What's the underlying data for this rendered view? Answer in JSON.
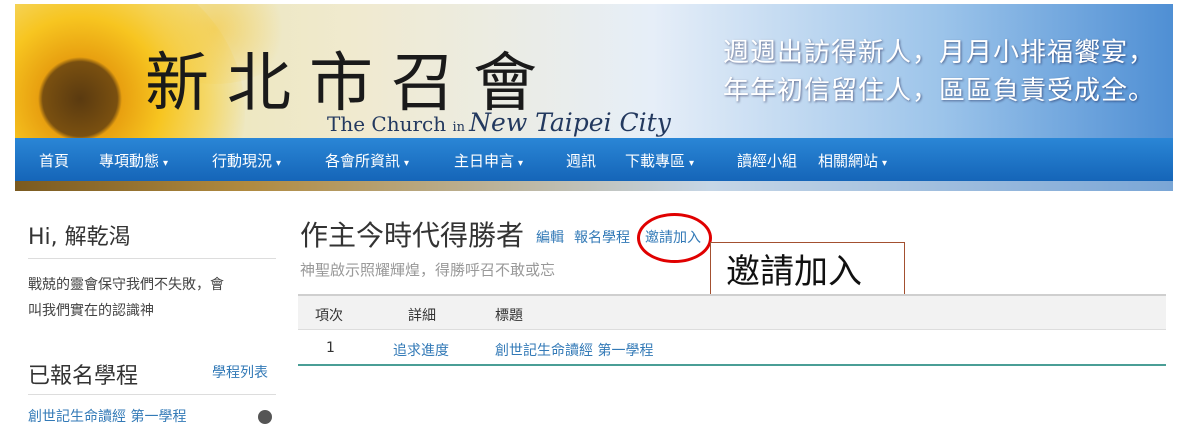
{
  "header": {
    "logo_cn": "新北市召會",
    "logo_en_prefix": "The Church ",
    "logo_en_in": "in ",
    "logo_en_city": "New Taipei City",
    "slogan_line1": "週週出訪得新人，月月小排福饗宴，",
    "slogan_line2": "年年初信留住人，區區負責受成全。"
  },
  "nav": {
    "items": [
      {
        "label": "首頁",
        "dropdown": false
      },
      {
        "label": "專項動態",
        "dropdown": true
      },
      {
        "label": "行動現況",
        "dropdown": true
      },
      {
        "label": "各會所資訊",
        "dropdown": true
      },
      {
        "label": "主日申言",
        "dropdown": true
      },
      {
        "label": "週訊",
        "dropdown": false
      },
      {
        "label": "下載專區",
        "dropdown": true
      },
      {
        "label": "讀經小組",
        "dropdown": false
      },
      {
        "label": "相關網站",
        "dropdown": true
      }
    ],
    "caret": "▾"
  },
  "sidebar": {
    "greeting": "Hi, 解乾渴",
    "verse_line1": "戰兢的靈會保守我們不失敗，會",
    "verse_line2": "叫我們實在的認識神",
    "courses_title": "已報名學程",
    "courses_link": "學程列表",
    "course_item": "創世記生命讀經 第一學程"
  },
  "main": {
    "title": "作主今時代得勝者",
    "actions": {
      "edit": "編輯",
      "enroll": "報名學程",
      "invite": "邀請加入"
    },
    "subtitle": "神聖啟示照耀輝煌，得勝呼召不敢或忘",
    "callout": "邀請加入",
    "table": {
      "headers": [
        "項次",
        "詳細",
        "標題"
      ],
      "rows": [
        {
          "index": "1",
          "detail": "追求進度",
          "title": "創世記生命讀經 第一學程"
        }
      ]
    }
  },
  "colors": {
    "link": "#337ab7",
    "nav": "#1e77c9",
    "highlight": "#e00000",
    "table_accent": "#4a9e96"
  }
}
